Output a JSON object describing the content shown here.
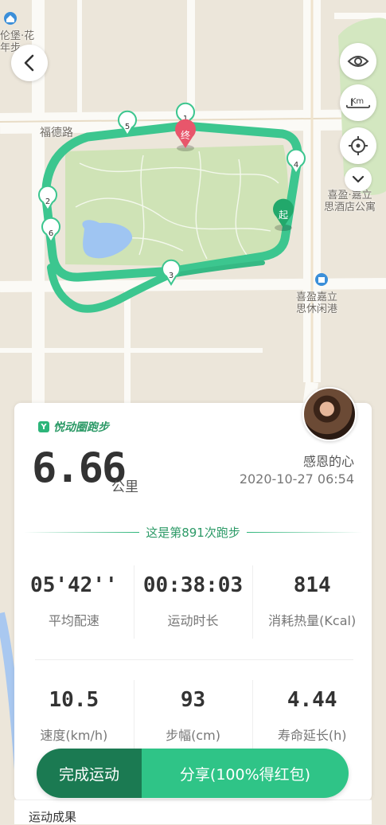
{
  "map": {
    "road_label": "福德路",
    "poi_top_left": "伦堡·花\n年步",
    "poi_right_1": "喜盈·嘉立\n思酒店公寓",
    "poi_right_2": "喜盈嘉立\n思休闲港",
    "markers": [
      "1",
      "2",
      "3",
      "4",
      "5",
      "6"
    ],
    "end_label": "终",
    "start_label": "起"
  },
  "controls": {
    "back_icon": "chevron-left-icon",
    "eye_icon": "eye-icon",
    "km_icon": "km-icon",
    "km_text": "Km",
    "locate_icon": "crosshair-icon",
    "expand_icon": "chevron-down-icon"
  },
  "card": {
    "brand": "悦动圈跑步",
    "distance": "6.66",
    "distance_unit": "公里",
    "user_name": "感恩的心",
    "datetime": "2020-10-27 06:54",
    "run_count_text": "这是第891次跑步",
    "stats_row1": [
      {
        "value": "05'42''",
        "label": "平均配速"
      },
      {
        "value": "00:38:03",
        "label": "运动时长"
      },
      {
        "value": "814",
        "label": "消耗热量(Kcal)"
      }
    ],
    "stats_row2": [
      {
        "value": "10.5",
        "label": "速度(km/h)"
      },
      {
        "value": "93",
        "label": "步幅(cm)"
      },
      {
        "value": "4.44",
        "label": "寿命延长(h)"
      }
    ]
  },
  "actions": {
    "finish": "完成运动",
    "share": "分享(100%得红包)"
  },
  "bottom": {
    "peek_text": "运动成果"
  },
  "colors": {
    "route": "#3cc68f",
    "accent": "#2db57a",
    "end_marker": "#e8566b",
    "park": "#cfe3b6"
  }
}
